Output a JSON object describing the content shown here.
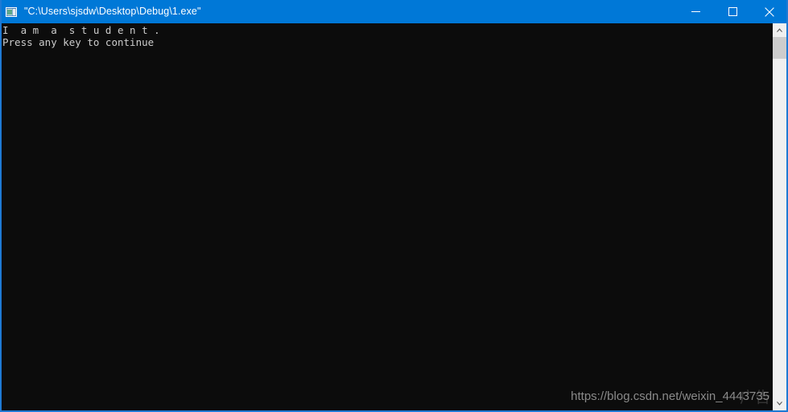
{
  "window": {
    "title": "\"C:\\Users\\sjsdw\\Desktop\\Debug\\1.exe\"",
    "icon": "console-app-icon",
    "titlebar_color": "#0078d7",
    "border_color": "#1e7ad4",
    "background_color": "#0c0c0c",
    "controls": {
      "minimize_label": "–",
      "maximize_label": "□",
      "close_label": "✕"
    }
  },
  "console": {
    "text_color": "#cccccc",
    "lines": [
      "I  a m  a  s t u d e n t .",
      "Press any key to continue"
    ]
  },
  "scrollbar": {
    "up_arrow": "▲",
    "down_arrow": "▼",
    "track_color": "#f0f0f0",
    "thumb_color": "#cdcdcd"
  },
  "watermark": {
    "text": "https://blog.csdn.net/weixin_4443735",
    "overlay_text": "广告",
    "color": "#8a8a8a"
  }
}
